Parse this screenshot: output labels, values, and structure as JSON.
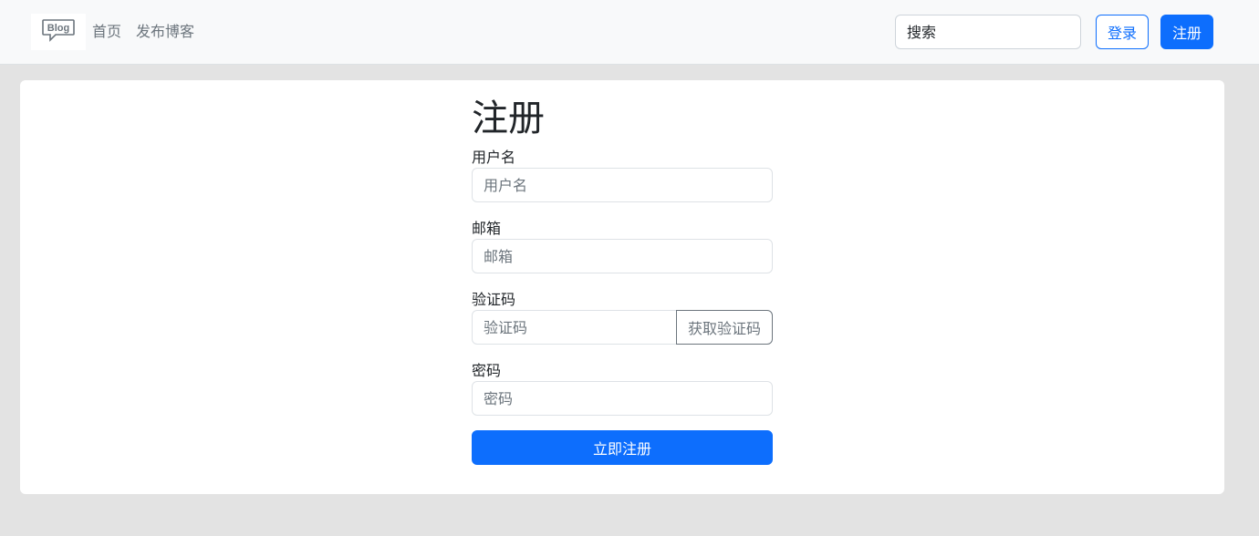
{
  "navbar": {
    "logo_text": "Blog",
    "links": [
      {
        "label": "首页"
      },
      {
        "label": "发布博客"
      }
    ],
    "search": {
      "placeholder": "搜索"
    },
    "login_label": "登录",
    "register_label": "注册"
  },
  "form": {
    "title": "注册",
    "username": {
      "label": "用户名",
      "placeholder": "用户名"
    },
    "email": {
      "label": "邮箱",
      "placeholder": "邮箱"
    },
    "code": {
      "label": "验证码",
      "placeholder": "验证码",
      "button_label": "获取验证码"
    },
    "password": {
      "label": "密码",
      "placeholder": "密码"
    },
    "submit_label": "立即注册"
  },
  "colors": {
    "primary": "#0d6efd",
    "secondary": "#6c757d",
    "navbar_bg": "#f8f9fa",
    "page_bg": "#e3e3e3"
  }
}
